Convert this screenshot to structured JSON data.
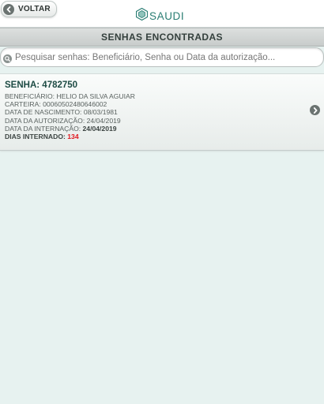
{
  "header": {
    "back_label": "VOLTAR",
    "logo_text": "SAUDI"
  },
  "page_title": "SENHAS ENCONTRADAS",
  "search": {
    "placeholder": "Pesquisar senhas: Beneficiário, Senha ou Data da autorização..."
  },
  "results": [
    {
      "senha_label": "SENHA:",
      "senha_value": "4782750",
      "beneficiario_label": "BENEFICIÁRIO:",
      "beneficiario_value": "HELIO DA SILVA AGUIAR",
      "carteira_label": "CARTEIRA:",
      "carteira_value": "00060502480646002",
      "nascimento_label": "DATA DE NASCIMENTO:",
      "nascimento_value": "08/03/1981",
      "autorizacao_label": "DATA DA AUTORIZAÇÃO:",
      "autorizacao_value": "24/04/2019",
      "internacao_label": "DATA DA INTERNAÇÃO:",
      "internacao_value": "24/04/2019",
      "dias_label": "DIAS INTERNADO:",
      "dias_value": "134"
    }
  ],
  "colors": {
    "accent": "#2a7d73",
    "highlight_red": "#e0171e",
    "background": "#e7f2f0"
  }
}
